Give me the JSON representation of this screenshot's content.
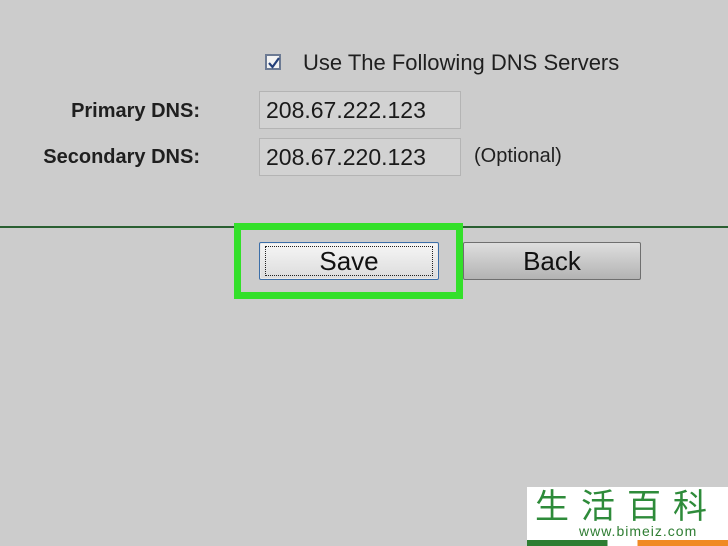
{
  "dns": {
    "checkbox_checked": true,
    "checkbox_label": "Use The Following DNS Servers",
    "primary_label": "Primary DNS:",
    "primary_value": "208.67.222.123",
    "secondary_label": "Secondary DNS:",
    "secondary_value": "208.67.220.123",
    "optional_hint": "(Optional)"
  },
  "buttons": {
    "save_label": "Save",
    "back_label": "Back"
  },
  "watermark": {
    "logo_text": "生活百科",
    "url_text": "www.bimeiz.com"
  },
  "colors": {
    "background": "#cccccc",
    "highlight": "#33e02a",
    "divider": "#2a5f32"
  }
}
